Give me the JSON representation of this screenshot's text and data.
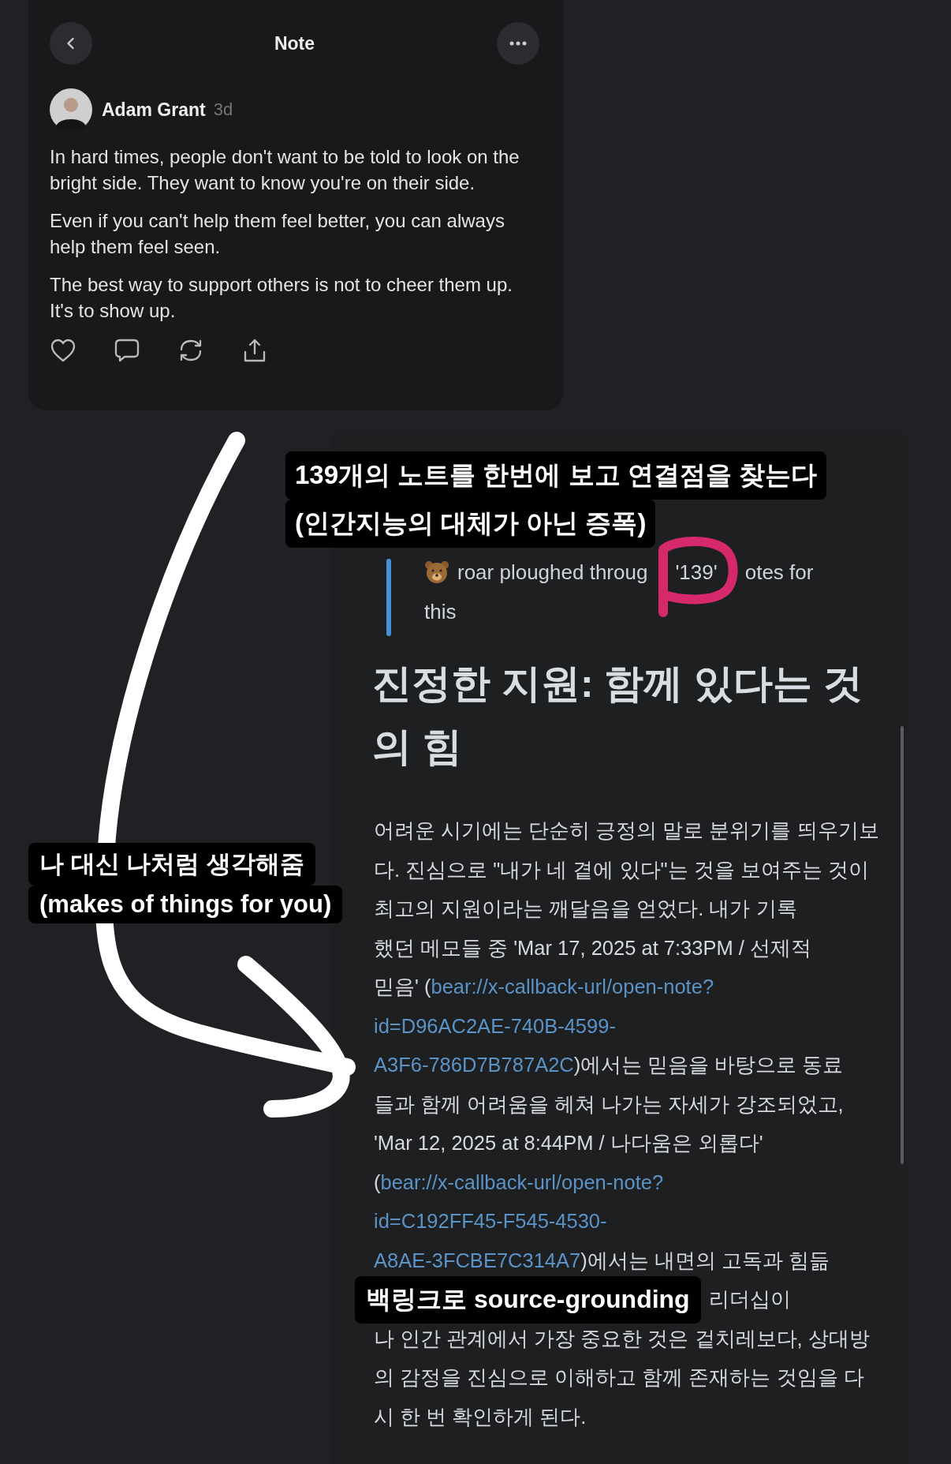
{
  "note_card": {
    "title": "Note",
    "author": "Adam Grant",
    "time": "3d",
    "paragraphs": [
      "In hard times, people don't want to be told to look on the bright side. They want to know you're on their side.",
      "Even if you can't help them feel better, you can always help them feel seen.",
      "The best way to support others is not to cheer them up. It's to show up."
    ]
  },
  "annotations": {
    "top_label": [
      "139개의 노트를 한번에 보고 연결점을 찾는다",
      "(인간지능의 대체가 아닌 증폭)"
    ],
    "side_label": [
      "나 대신 나처럼 생각해줌",
      "(makes of things for you)"
    ],
    "bottom_label": "백링크로 source-grounding"
  },
  "ai_note": {
    "quote": {
      "line_start": "roar ploughed throug",
      "circled": "'139'",
      "line_end": "otes for",
      "line_2": "this"
    },
    "heading": [
      "진정한 지원: 함께 있다는 것",
      "의 힘"
    ],
    "body_lines": [
      {
        "kind": "plain",
        "segments": [
          {
            "kind": "text",
            "text": "어려운 시기에는 단순히 긍정의 말로 분위기를 띄우기보"
          }
        ]
      },
      {
        "kind": "plain",
        "segments": [
          {
            "kind": "text",
            "text": "다. 진심으로 \"내가 네 곁에 있다\"는 것을 보여주는 것이"
          }
        ]
      },
      {
        "kind": "plain",
        "segments": [
          {
            "kind": "text",
            "text": "최고의 지원이라는 깨달음을 얻었다. 내가 기록"
          }
        ]
      },
      {
        "kind": "plain",
        "segments": [
          {
            "kind": "text",
            "text": "했던 메모들 중 'Mar 17, 2025 at 7:33PM / 선제적"
          }
        ]
      },
      {
        "kind": "plain",
        "segments": [
          {
            "kind": "text",
            "text": "믿음' ("
          },
          {
            "kind": "link",
            "text": "bear://x-callback-url/open-note?"
          }
        ]
      },
      {
        "kind": "plain",
        "segments": [
          {
            "kind": "link",
            "text": "id=D96AC2AE-740B-4599-"
          }
        ]
      },
      {
        "kind": "plain",
        "segments": [
          {
            "kind": "link",
            "text": "A3F6-786D7B787A2C"
          },
          {
            "kind": "text",
            "text": ")에서는 믿음을 바탕으로 동료"
          }
        ]
      },
      {
        "kind": "plain",
        "segments": [
          {
            "kind": "text",
            "text": "들과 함께 어려움을 헤쳐 나가는 자세가 강조되었고,"
          }
        ]
      },
      {
        "kind": "plain",
        "segments": [
          {
            "kind": "text",
            "text": "'Mar 12, 2025 at 8:44PM / 나다움은 외롭다'"
          }
        ]
      },
      {
        "kind": "plain",
        "segments": [
          {
            "kind": "text",
            "text": "("
          },
          {
            "kind": "link",
            "text": "bear://x-callback-url/open-note?"
          }
        ]
      },
      {
        "kind": "plain",
        "segments": [
          {
            "kind": "link",
            "text": "id=C192FF45-F545-4530-"
          }
        ]
      },
      {
        "kind": "plain",
        "segments": [
          {
            "kind": "link",
            "text": "A8AE-3FCBE7C314A7"
          },
          {
            "kind": "text",
            "text": ")에서는 내면의 고독과 힘듦"
          }
        ]
      },
      {
        "kind": "annotated",
        "segments": [
          {
            "kind": "text",
            "text": "리더십이"
          }
        ]
      },
      {
        "kind": "plain",
        "segments": [
          {
            "kind": "text",
            "text": "나 인간 관계에서 가장 중요한 것은 겉치레보다, 상대방"
          }
        ]
      },
      {
        "kind": "plain",
        "segments": [
          {
            "kind": "text",
            "text": "의 감정을 진심으로 이해하고 함께 존재하는 것임을 다"
          }
        ]
      },
      {
        "kind": "plain",
        "segments": [
          {
            "kind": "text",
            "text": "시 한 번 확인하게 된다."
          }
        ]
      }
    ]
  }
}
